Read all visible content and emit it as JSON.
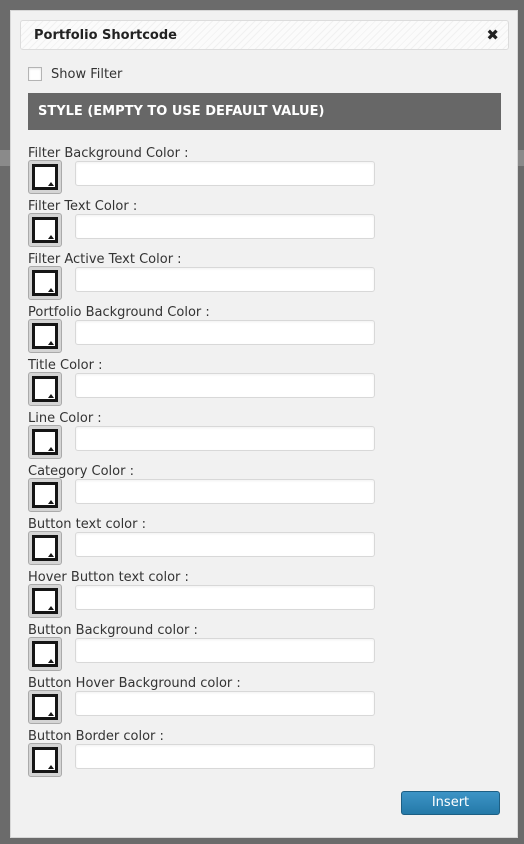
{
  "dialog": {
    "title": "Portfolio Shortcode",
    "close_glyph": "✖",
    "close_icon": "close-icon"
  },
  "filter": {
    "label": "Show Filter",
    "checked": false
  },
  "style_section": {
    "heading": "STYLE (EMPTY TO USE DEFAULT VALUE)"
  },
  "fields": [
    {
      "label": "Filter Background Color :",
      "value": ""
    },
    {
      "label": "Filter Text Color :",
      "value": ""
    },
    {
      "label": "Filter Active Text Color :",
      "value": ""
    },
    {
      "label": "Portfolio Background Color :",
      "value": ""
    },
    {
      "label": "Title Color :",
      "value": ""
    },
    {
      "label": "Line Color :",
      "value": ""
    },
    {
      "label": "Category Color :",
      "value": ""
    },
    {
      "label": "Button text color :",
      "value": ""
    },
    {
      "label": "Hover Button text color :",
      "value": ""
    },
    {
      "label": "Button Background color :",
      "value": ""
    },
    {
      "label": "Button Hover Background color :",
      "value": ""
    },
    {
      "label": "Button Border color :",
      "value": ""
    }
  ],
  "actions": {
    "insert_label": "Insert"
  },
  "colors": {
    "overlay": "#6b6b6b",
    "modal_bg": "#f1f1f1",
    "section_header": "#676767",
    "swatch_border": "#151515",
    "swatch_fill": "#ffffff",
    "primary_button": "#2e86b8"
  }
}
